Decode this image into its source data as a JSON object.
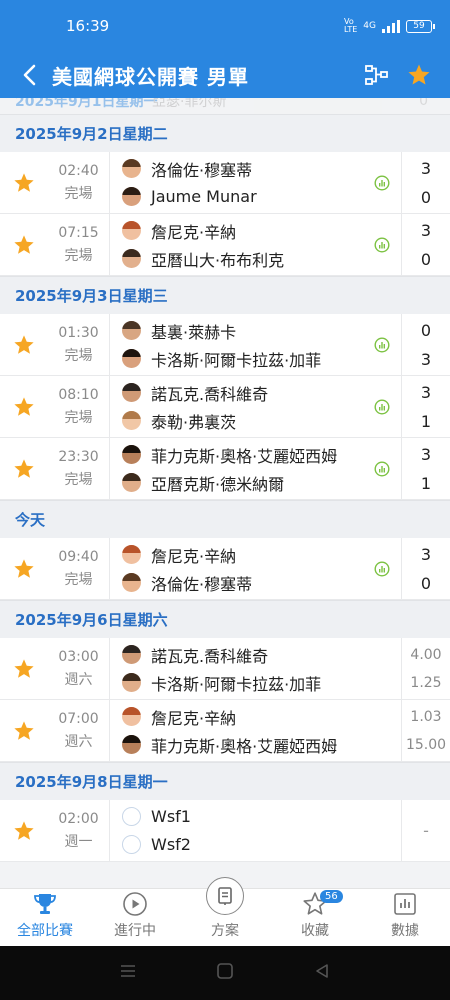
{
  "status": {
    "time": "16:39",
    "network": "4G",
    "volte": "VoLTE",
    "battery": "59"
  },
  "header": {
    "title": "美國網球公開賽 男單"
  },
  "prev_stub": {
    "date": "2025年9月1日星期一",
    "ghost_text": "亞瑟·菲尔斯",
    "ghost_score": "0"
  },
  "sections": [
    {
      "date": "2025年9月2日星期二",
      "matches": [
        {
          "time": "02:40",
          "status": "完場",
          "p1": "洛倫佐·穆塞蒂",
          "p2": "Jaume Munar",
          "s1": "3",
          "s2": "0"
        },
        {
          "time": "07:15",
          "status": "完場",
          "p1": "詹尼克·辛納",
          "p2": "亞曆山大·布布利克",
          "s1": "3",
          "s2": "0"
        }
      ]
    },
    {
      "date": "2025年9月3日星期三",
      "matches": [
        {
          "time": "01:30",
          "status": "完場",
          "p1": "基裏·萊赫卡",
          "p2": "卡洛斯·阿爾卡拉茲·加菲",
          "s1": "0",
          "s2": "3"
        },
        {
          "time": "08:10",
          "status": "完場",
          "p1": "諾瓦克.喬科維奇",
          "p2": "泰勒·弗裏茨",
          "s1": "3",
          "s2": "1"
        },
        {
          "time": "23:30",
          "status": "完場",
          "p1": "菲力克斯·奧格·艾麗婭西姆",
          "p2": "亞曆克斯·德米納爾",
          "s1": "3",
          "s2": "1"
        }
      ]
    },
    {
      "date": "今天",
      "matches": [
        {
          "time": "09:40",
          "status": "完場",
          "p1": "詹尼克·辛納",
          "p2": "洛倫佐·穆塞蒂",
          "s1": "3",
          "s2": "0"
        }
      ]
    },
    {
      "date": "2025年9月6日星期六",
      "matches": [
        {
          "time": "03:00",
          "status": "週六",
          "p1": "諾瓦克.喬科維奇",
          "p2": "卡洛斯·阿爾卡拉茲·加菲",
          "o1": "4.00",
          "o2": "1.25"
        },
        {
          "time": "07:00",
          "status": "週六",
          "p1": "詹尼克·辛納",
          "p2": "菲力克斯·奧格·艾麗婭西姆",
          "o1": "1.03",
          "o2": "15.00"
        }
      ]
    },
    {
      "date": "2025年9月8日星期一",
      "matches": [
        {
          "time": "02:00",
          "status": "週一",
          "p1": "Wsf1",
          "p2": "Wsf2",
          "dash": "-"
        }
      ]
    }
  ],
  "tabs": {
    "all": "全部比賽",
    "live": "進行中",
    "plan": "方案",
    "fav": "收藏",
    "fav_badge": "56",
    "data": "數據"
  },
  "colors": {
    "accent": "#2a86e0",
    "star": "#f6a623",
    "stats": "#7cc242"
  }
}
